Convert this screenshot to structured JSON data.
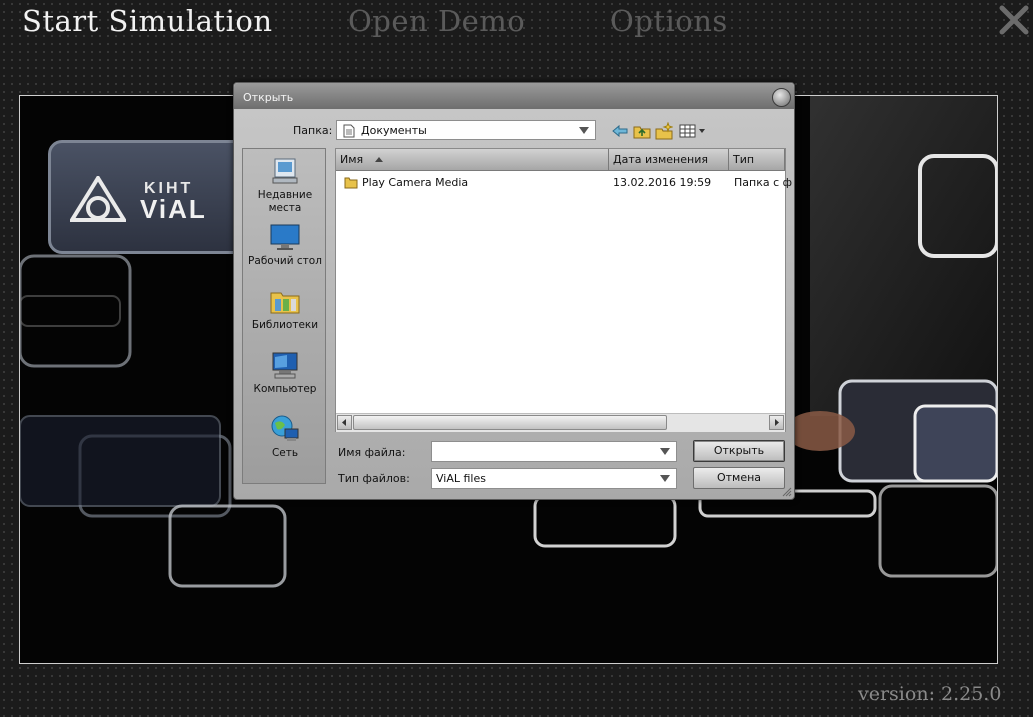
{
  "menu": {
    "start_simulation": "Start Simulation",
    "open_demo": "Open Demo",
    "options": "Options"
  },
  "logo": {
    "line1": "KIHT",
    "line2": "ViAL"
  },
  "version": "version: 2.25.0",
  "dialog": {
    "title": "Открыть",
    "folder_label": "Папка:",
    "folder_value": "Документы",
    "places": [
      {
        "label": "Недавние места",
        "icon": "recent-places-icon"
      },
      {
        "label": "Рабочий стол",
        "icon": "desktop-icon"
      },
      {
        "label": "Библиотеки",
        "icon": "libraries-icon"
      },
      {
        "label": "Компьютер",
        "icon": "computer-icon"
      },
      {
        "label": "Сеть",
        "icon": "network-icon"
      }
    ],
    "columns": {
      "name": "Имя",
      "date": "Дата изменения",
      "type": "Тип"
    },
    "files": [
      {
        "name": "Play Camera Media",
        "date": "13.02.2016 19:59",
        "type": "Папка с ф"
      }
    ],
    "filename_label": "Имя файла:",
    "filename_value": "",
    "filetype_label": "Тип файлов:",
    "filetype_value": "ViAL files",
    "open_button": "Открыть",
    "cancel_button": "Отмена"
  },
  "colors": {
    "menu_active": "#f2f2f2",
    "menu_inactive": "#5a5a5a",
    "folder_yellow": "#e8c24a"
  }
}
